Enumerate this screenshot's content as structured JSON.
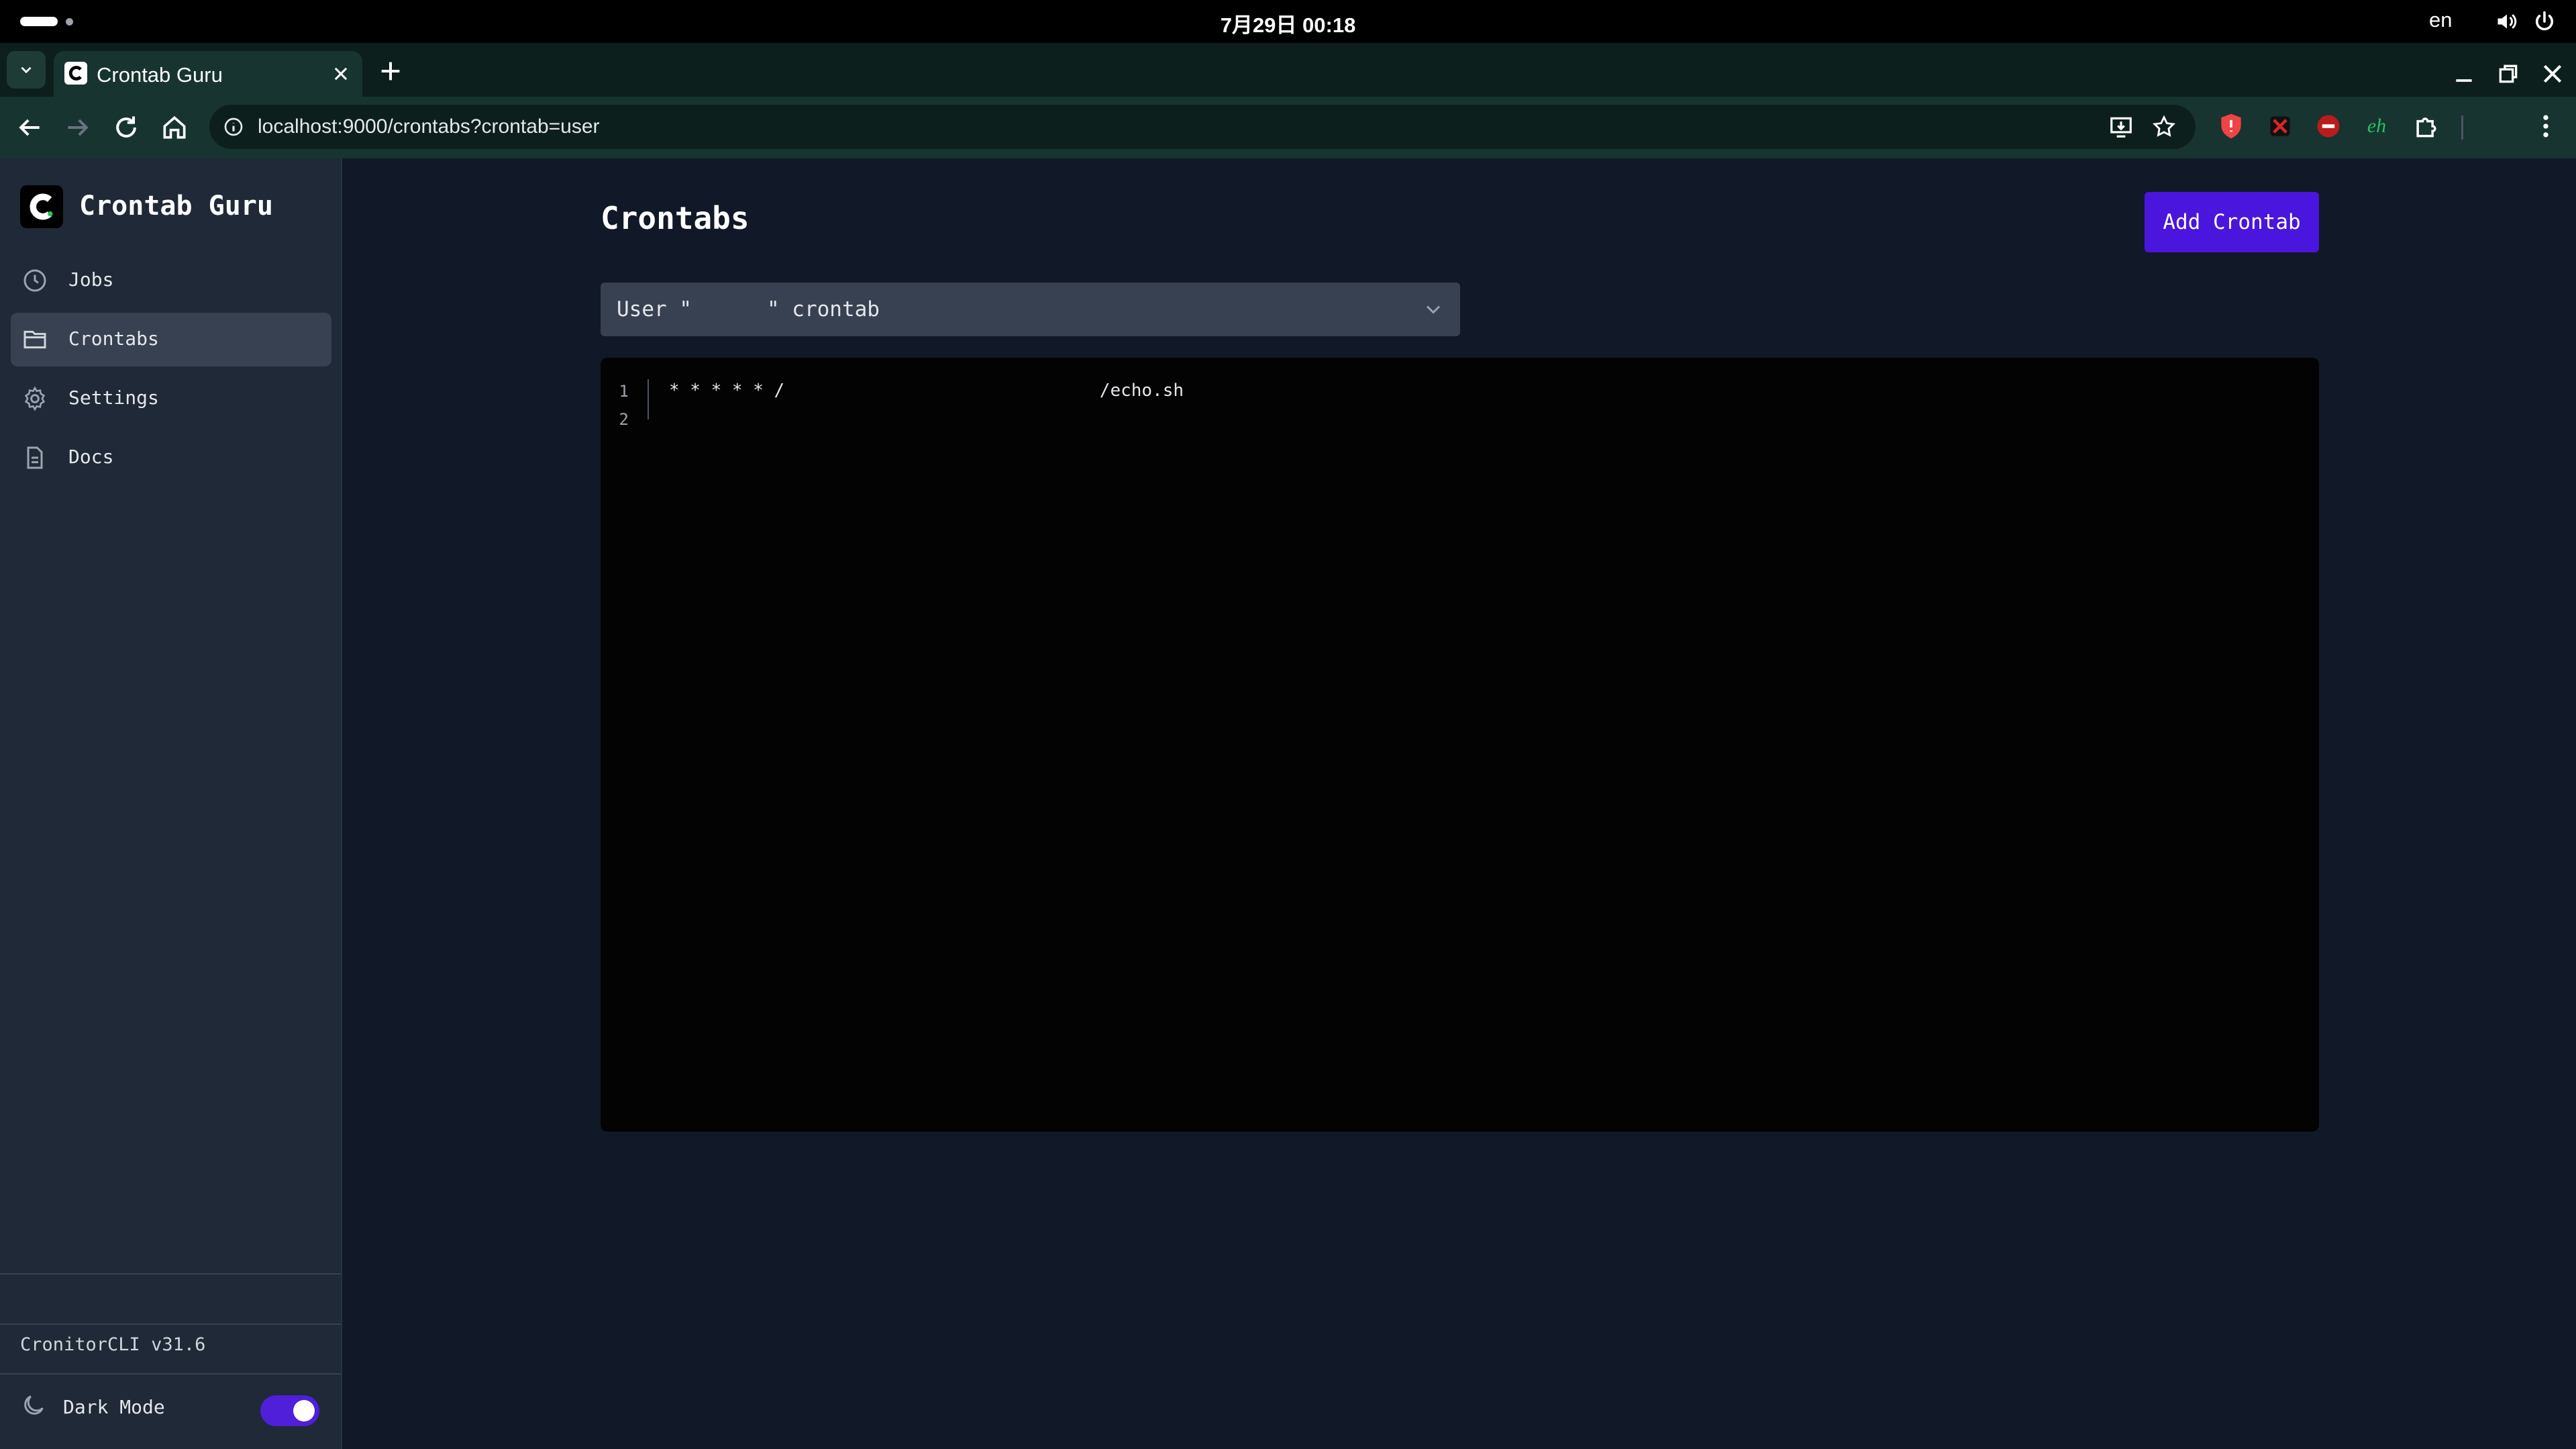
{
  "os": {
    "clock": "7月29日  00:18",
    "lang": "en"
  },
  "browser": {
    "tab_title": "Crontab Guru",
    "url": "localhost:9000/crontabs?crontab=user"
  },
  "sidebar": {
    "brand": "Crontab Guru",
    "items": [
      {
        "label": "Jobs",
        "icon": "clock-icon",
        "active": false
      },
      {
        "label": "Crontabs",
        "icon": "folder-icon",
        "active": true
      },
      {
        "label": "Settings",
        "icon": "gear-icon",
        "active": false
      },
      {
        "label": "Docs",
        "icon": "document-icon",
        "active": false
      }
    ],
    "version": "CronitorCLI v31.6",
    "dark_mode_label": "Dark Mode",
    "dark_mode_on": true
  },
  "main": {
    "title": "Crontabs",
    "add_button": "Add Crontab",
    "select_value": "User \"      \" crontab",
    "editor": {
      "line_numbers": [
        "1",
        "2"
      ],
      "lines": [
        "* * * * * /                              /echo.sh",
        ""
      ]
    }
  },
  "colors": {
    "accent": "#4a15dc",
    "page_bg": "#111827",
    "sidebar_bg": "#1f2937",
    "editor_bg": "#030303"
  }
}
